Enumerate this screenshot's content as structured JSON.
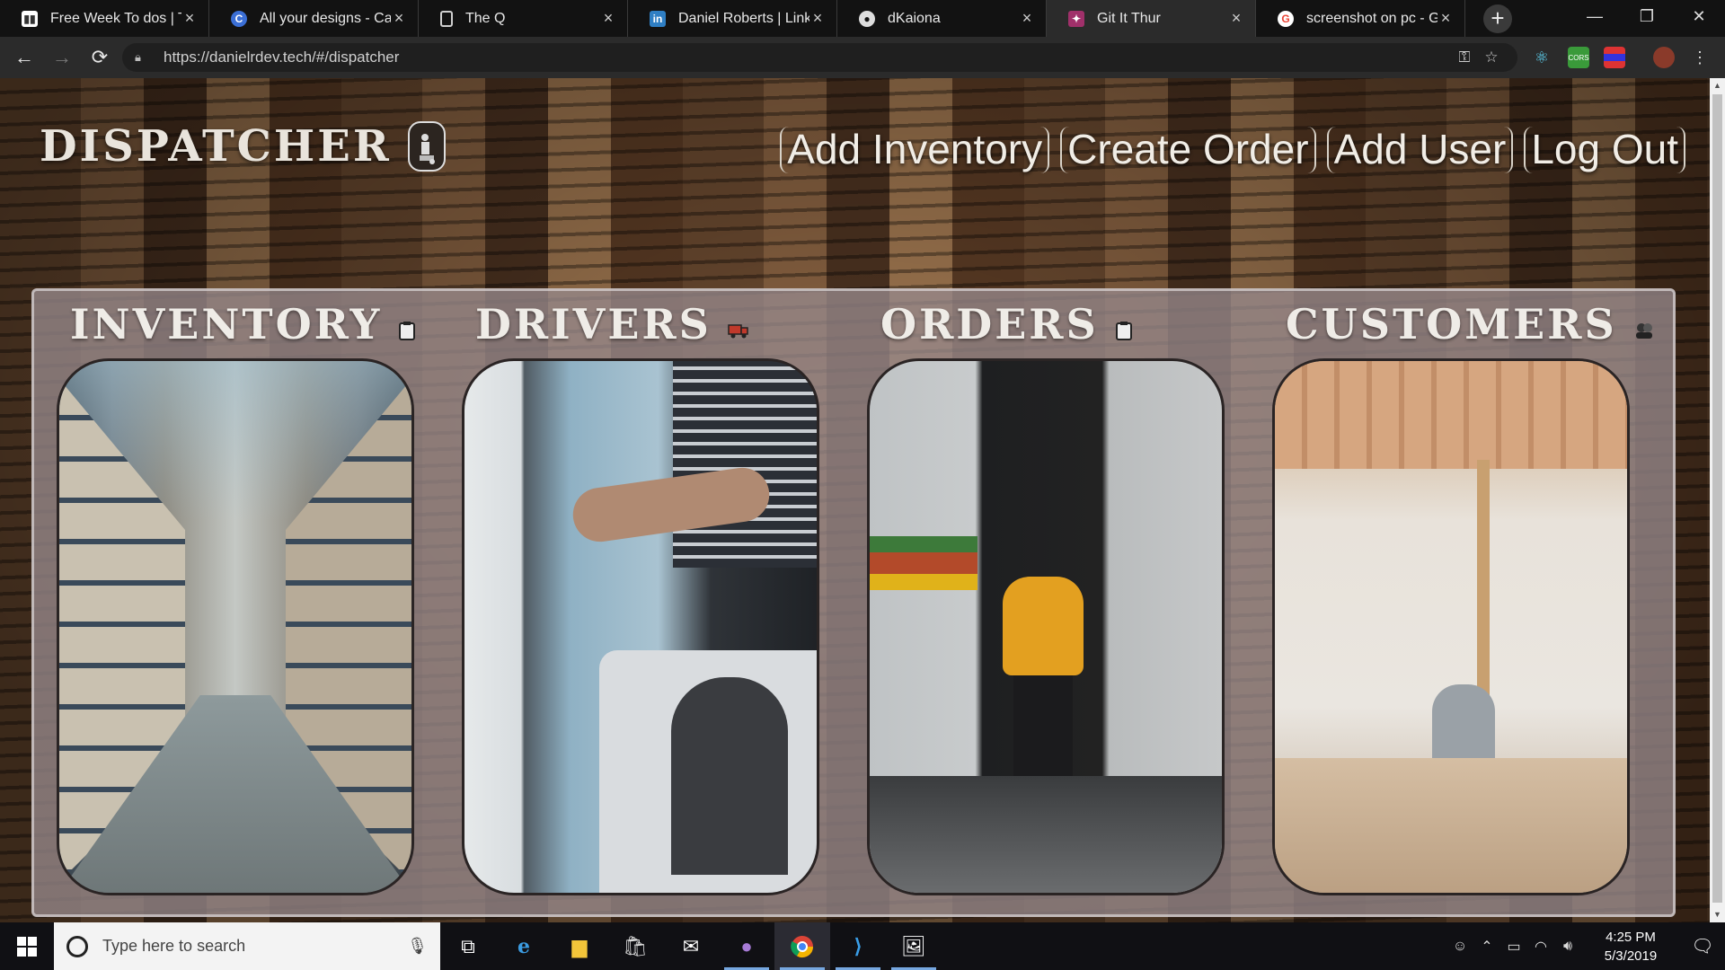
{
  "browser": {
    "tabs": [
      {
        "title": "Free Week To dos | Trello",
        "icon": "trello-icon",
        "color": "#ffffff",
        "active": false
      },
      {
        "title": "All your designs - Canva",
        "icon": "canva-icon",
        "color": "#3b6fd6",
        "active": false
      },
      {
        "title": "The Q",
        "icon": "document-icon",
        "color": "#cfcfcf",
        "active": false
      },
      {
        "title": "Daniel Roberts | LinkedIn",
        "icon": "linkedin-icon",
        "color": "#2f7fc4",
        "active": false
      },
      {
        "title": "dKaiona",
        "icon": "github-icon",
        "color": "#dddddd",
        "active": false
      },
      {
        "title": "Git It Thur",
        "icon": "git-it-thur-icon",
        "color": "#a0306a",
        "active": true
      },
      {
        "title": "screenshot on pc - Google",
        "icon": "google-icon",
        "color": "#ea4335",
        "active": false
      }
    ],
    "url": "https://danielrdev.tech/#/dispatcher"
  },
  "app": {
    "brand": "DISPATCHER",
    "nav": {
      "add_inventory": "Add Inventory",
      "create_order": "Create Order",
      "add_user": "Add User",
      "log_out": "Log Out"
    },
    "sections": [
      {
        "key": "inventory",
        "title": "INVENTORY",
        "icon": "clipboard-icon"
      },
      {
        "key": "drivers",
        "title": "DRIVERS",
        "icon": "truck-icon"
      },
      {
        "key": "orders",
        "title": "ORDERS",
        "icon": "clipboard-icon"
      },
      {
        "key": "customers",
        "title": "CUSTOMERS",
        "icon": "users-icon"
      }
    ]
  },
  "taskbar": {
    "search_placeholder": "Type here to search",
    "apps": [
      "task-view-icon",
      "edge-icon",
      "file-explorer-icon",
      "store-icon",
      "mail-icon",
      "github-desktop-icon",
      "chrome-icon",
      "vscode-icon",
      "photos-icon"
    ],
    "time": "4:25 PM",
    "date": "5/3/2019"
  },
  "colors": {
    "panel": "#968a8a",
    "nav_text": "#f1ede6",
    "taskbar": "#101014"
  }
}
